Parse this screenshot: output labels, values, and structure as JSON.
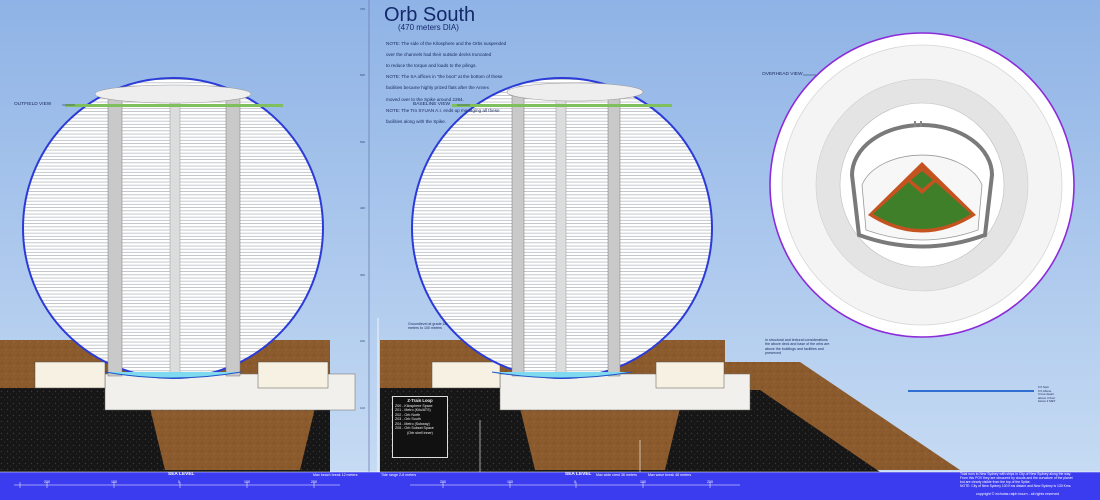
{
  "title": "Orb South",
  "subtitle": "(470 meters DIA)",
  "notes": [
    "NOTE:  The side of the Kilosphere and the Orbs suspended",
    "          over the channels had their outside decks truncated",
    "          to reduce the torque and loads to the pilings.",
    "NOTE:  The SA offices in \"the boot\" at the bottom of these",
    "          facilities became highly prized flats after the Annex",
    "          moved over to the Spike around 2284.",
    "NOTE:  The Tro SYUAN A.I. ends up managing all these",
    "          facilities along with the Spike."
  ],
  "views": {
    "outfield": "OUTFIELD VIEW",
    "baseline": "BASELINE VIEW",
    "overhead": "OVERHEAD VIEW"
  },
  "sea_level": "SEA LEVEL",
  "annotations": {
    "grade_note": "Groundlevel at grade 18 meters to 100 meters",
    "structural_note": "In structural and textural considerations the above deck and base of the orbs are above the buildings and facilities and preserved",
    "max_beach": "Max beach break 12 meters",
    "tide_range": "Tide range 2-6 meters",
    "max_wide_crest": "Max wide crest 36 meters",
    "max_wave": "Max wave break 48 meters",
    "right_dim": "6 ft Spm\n6 ft Above\n3 foot detail\nabove 3 floor\nbelow 3 MET"
  },
  "legend": {
    "title": "Z-Train Loop",
    "items": [
      "Z00 - Kilosphere Space",
      "Z01 - Metro (Kilo/ATS)",
      "Z02 - Orb North",
      "Z03 - Orb South",
      "Z04 - Metro (Subway)",
      "Z05 - Orb Subset Space",
      "(Orb shell inner)"
    ]
  },
  "bottom_note": [
    "Tidal runs to New Sydney with ships in City of New Sydney along the way.",
    "From this POV they are obscured by clouds and the curvature of the planet",
    "but are clearly visible from the top of the Spike.",
    "NOTE:  City of New Sydney 100 Kms distant and New Sydney is 130 Kms."
  ],
  "copyright": "copyright © nicholas ralph bourn - all rights reserved",
  "scale_ticks": [
    "200",
    "100",
    "0",
    "100",
    "200"
  ],
  "colors": {
    "sky": "#a9c8ee",
    "sea_band": "#3b3bf0",
    "orb_outline_blue": "#2b3bd8",
    "orb_outline_purple": "#8c2bd8",
    "earth": "#8a5a2c",
    "asphalt": "#1b1b1b",
    "field_green": "#3f7f2a",
    "infield_orange": "#c55320"
  }
}
